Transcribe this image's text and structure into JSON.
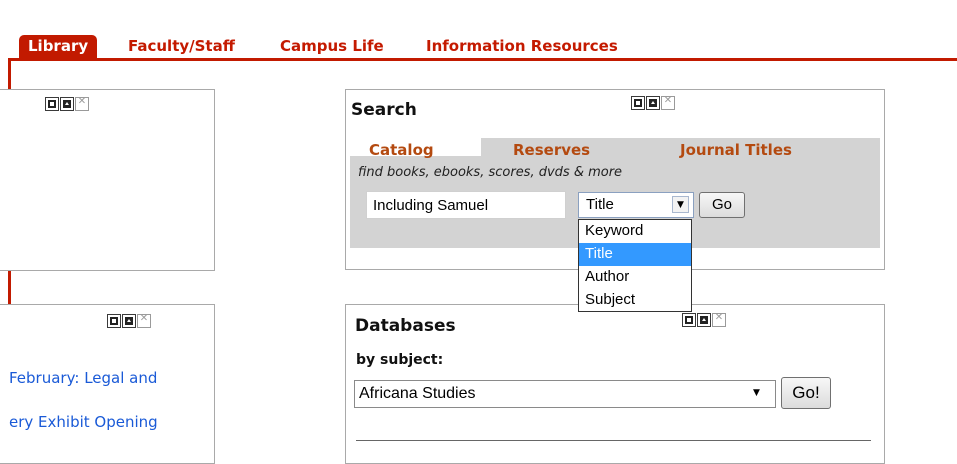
{
  "nav": {
    "tabs": [
      {
        "label": "Library",
        "active": true
      },
      {
        "label": "Faculty/Staff",
        "active": false
      },
      {
        "label": "Campus Life",
        "active": false
      },
      {
        "label": "Information Resources",
        "active": false
      }
    ]
  },
  "colors": {
    "brand_red": "#c21a00",
    "tab_orange": "#b44a10",
    "selection_blue": "#3399ff",
    "link_blue": "#1a5ad7"
  },
  "search": {
    "title": "Search",
    "tabs": [
      "Catalog",
      "Reserves",
      "Journal Titles"
    ],
    "active_tab": "Catalog",
    "hint": "find books, ebooks, scores, dvds & more",
    "query_value": "Including Samuel",
    "field_selected": "Title",
    "field_options": [
      "Keyword",
      "Title",
      "Author",
      "Subject"
    ],
    "go_label": "Go"
  },
  "databases": {
    "title": "Databases",
    "by_subject_label": "by subject:",
    "subject_selected": "Africana Studies",
    "go_label": "Go!"
  },
  "news": {
    "items": [
      "February: Legal and",
      "ery Exhibit Opening"
    ]
  },
  "icons": {
    "minimize": "minimize-icon",
    "move_top": "move-to-top-icon",
    "close": "close-icon",
    "dropdown": "chevron-down-icon"
  }
}
